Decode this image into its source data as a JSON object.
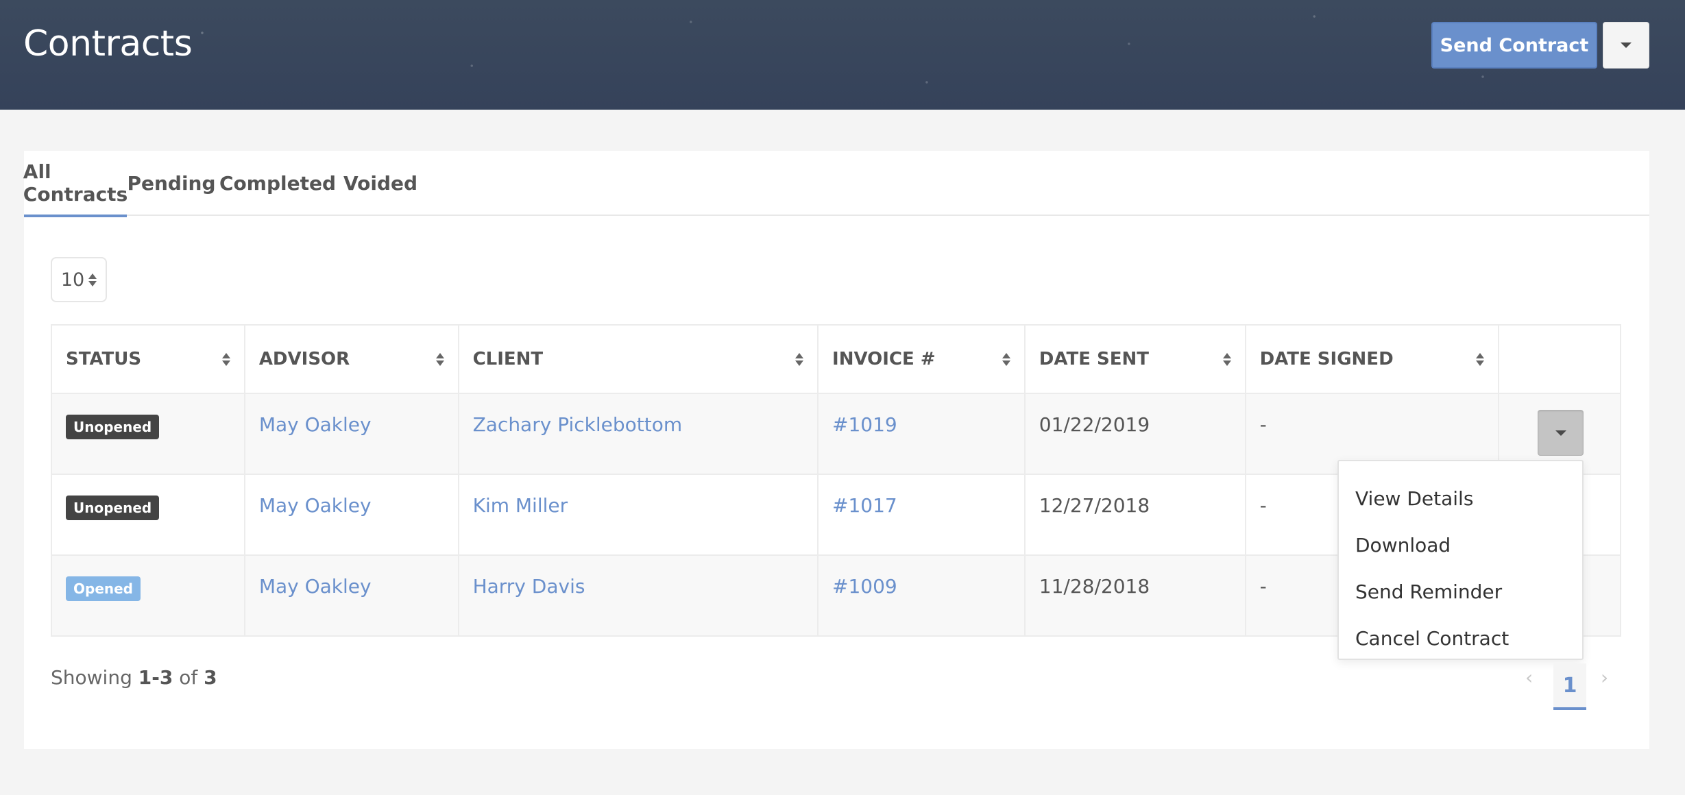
{
  "header": {
    "title": "Contracts",
    "send_contract_label": "Send Contract",
    "send_options_icon": "caret-down-icon"
  },
  "tabs": [
    {
      "label": "All Contracts",
      "active": true
    },
    {
      "label": "Pending",
      "active": false
    },
    {
      "label": "Completed",
      "active": false
    },
    {
      "label": "Voided",
      "active": false
    }
  ],
  "page_size": {
    "value": "10"
  },
  "table": {
    "columns": [
      "STATUS",
      "ADVISOR",
      "CLIENT",
      "INVOICE #",
      "DATE SENT",
      "DATE SIGNED",
      ""
    ],
    "rows": [
      {
        "status": "Unopened",
        "advisor": "May Oakley",
        "client": "Zachary Picklebottom",
        "invoice": "#1019",
        "date_sent": "01/22/2019",
        "date_signed": "-"
      },
      {
        "status": "Unopened",
        "advisor": "May Oakley",
        "client": "Kim Miller",
        "invoice": "#1017",
        "date_sent": "12/27/2018",
        "date_signed": "-"
      },
      {
        "status": "Opened",
        "advisor": "May Oakley",
        "client": "Harry Davis",
        "invoice": "#1009",
        "date_sent": "11/28/2018",
        "date_signed": "-"
      }
    ]
  },
  "row_menu": {
    "items": [
      "View Details",
      "Download",
      "Send Reminder",
      "Cancel Contract"
    ]
  },
  "footer": {
    "showing_prefix": "Showing ",
    "showing_range": "1-3",
    "showing_of": " of ",
    "showing_total": "3"
  },
  "pagination": {
    "prev": "‹",
    "current": "1",
    "next": "›"
  },
  "colors": {
    "accent": "#6a90cc",
    "header_bg": "#3a475a",
    "badge_unopened": "#444444",
    "badge_opened": "#85b6e6"
  }
}
